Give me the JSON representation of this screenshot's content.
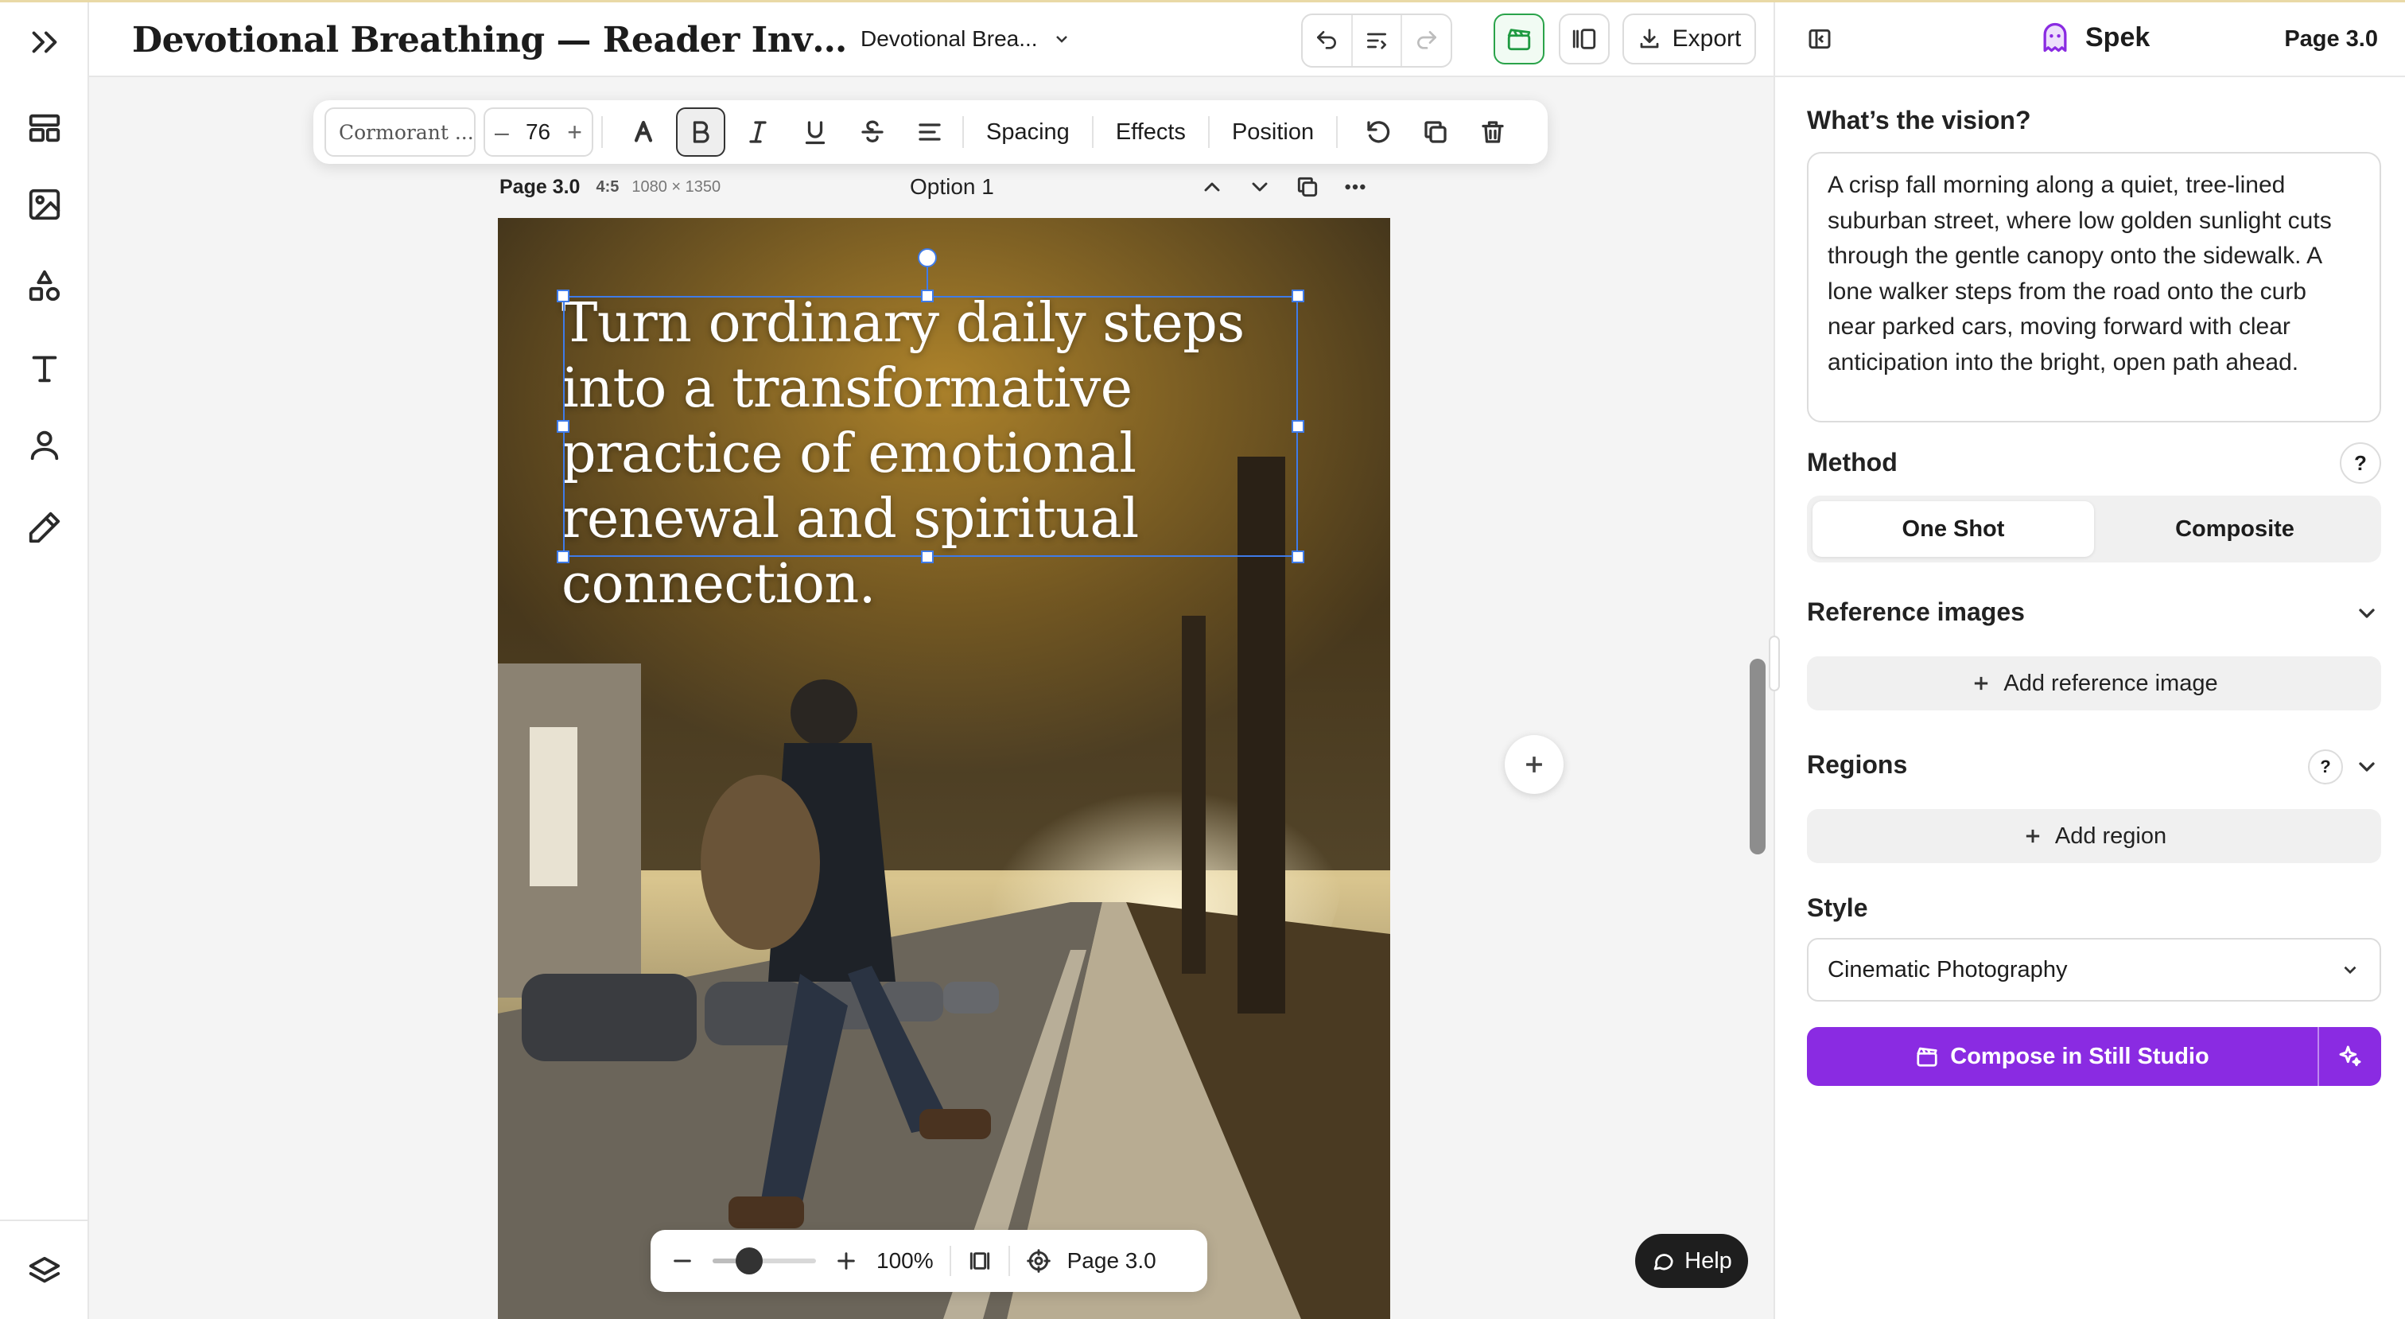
{
  "header": {
    "doc_title": "Devotional Breathing — Reader Invitati...",
    "doc_selector": "Devotional Brea...",
    "export_label": "Export"
  },
  "rail": {
    "icons": [
      "expand-icon",
      "layout-icon",
      "image-icon",
      "shapes-icon",
      "text-icon",
      "person-icon",
      "pen-icon",
      "layers-icon"
    ]
  },
  "format_toolbar": {
    "font_name": "Cormorant ...",
    "font_size": "76",
    "spacing_label": "Spacing",
    "effects_label": "Effects",
    "position_label": "Position"
  },
  "page_meta": {
    "page_label": "Page 3.0",
    "ratio": "4:5",
    "dimensions": "1080 × 1350",
    "option_label": "Option 1"
  },
  "artboard": {
    "headline": "Turn ordinary daily steps into a transformative practice of emotional renewal and spiritual connection."
  },
  "zoom": {
    "level": "100%",
    "level_value": 0.35,
    "page_label": "Page 3.0"
  },
  "help_label": "Help",
  "panel": {
    "brand": "Spek",
    "page_label": "Page 3.0",
    "vision_label": "What’s the vision?",
    "vision_text": "A crisp fall morning along a quiet, tree-lined suburban street, where low golden sunlight cuts through the gentle canopy onto the sidewalk. A lone walker steps from the road onto the curb near parked cars, moving forward with clear anticipation into the bright, open path ahead.",
    "method_label": "Method",
    "method_options": [
      "One Shot",
      "Composite"
    ],
    "method_selected": "One Shot",
    "reference_label": "Reference images",
    "add_reference_label": "Add reference image",
    "regions_label": "Regions",
    "add_region_label": "Add region",
    "style_label": "Style",
    "style_value": "Cinematic Photography",
    "compose_label": "Compose in Still Studio",
    "help_mark": "?"
  },
  "colors": {
    "accent_purple": "#8a2be2",
    "selection_blue": "#3f7be8",
    "active_green": "#1f9a41"
  }
}
